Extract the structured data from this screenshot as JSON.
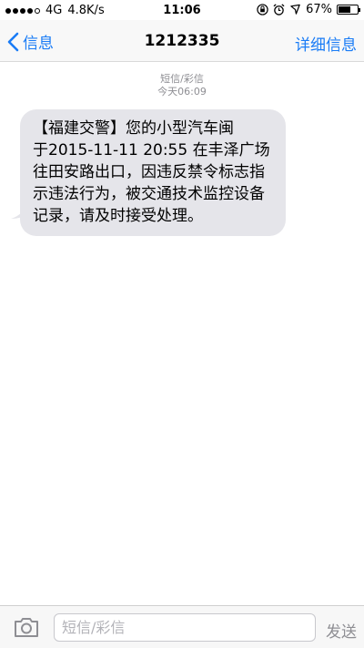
{
  "status_bar": {
    "carrier": "4G",
    "speed": "4.8K/s",
    "time": "11:06",
    "battery": "67%",
    "battery_level": 0.67,
    "signal_filled": 4,
    "signal_total": 5
  },
  "nav": {
    "back_label": "信息",
    "title": "1212335",
    "detail_label": "详细信息"
  },
  "thread": {
    "type_label": "短信/彩信",
    "timestamp": "今天06:09"
  },
  "message": {
    "text": "【福建交警】您的小型汽车闽　　　于2015-11-11 20:55 在丰泽广场往田安路出口，因违反禁令标志指示违法行为，被交通技术监控设备记录，请及时接受处理。"
  },
  "composer": {
    "placeholder": "短信/彩信",
    "value": "",
    "send_label": "发送"
  },
  "colors": {
    "accent": "#1a7cf6",
    "bubble": "#e5e5ea",
    "meta": "#8e8e93"
  },
  "icons": {
    "back": "chevron-left-icon",
    "camera": "camera-icon",
    "lock": "orientation-lock-icon",
    "alarm": "alarm-icon",
    "location": "location-icon"
  }
}
